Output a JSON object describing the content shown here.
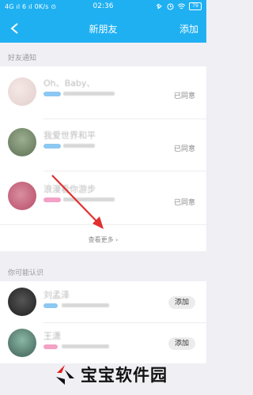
{
  "status_bar": {
    "left": "4G ıl 6 ıl 0K/s ⊙",
    "time": "02:36",
    "battery": "79"
  },
  "navbar": {
    "title": "新朋友",
    "add_label": "添加"
  },
  "friend_notices": {
    "label": "好友通知",
    "items": [
      {
        "name": "Oh、Baby、",
        "status": "已同意"
      },
      {
        "name": "我爱世界和平",
        "status": "已同意"
      },
      {
        "name": "浪漫看你游步",
        "status": "已同意"
      }
    ],
    "more_label": "查看更多 ›"
  },
  "may_know": {
    "label": "你可能认识",
    "items": [
      {
        "name": "刘孟泽",
        "add_label": "添加"
      },
      {
        "name": "王潇",
        "add_label": "添加"
      }
    ]
  },
  "watermark": {
    "text": "宝宝软件园"
  },
  "colors": {
    "brand": "#1fb0f2",
    "arrow": "#e03030"
  }
}
